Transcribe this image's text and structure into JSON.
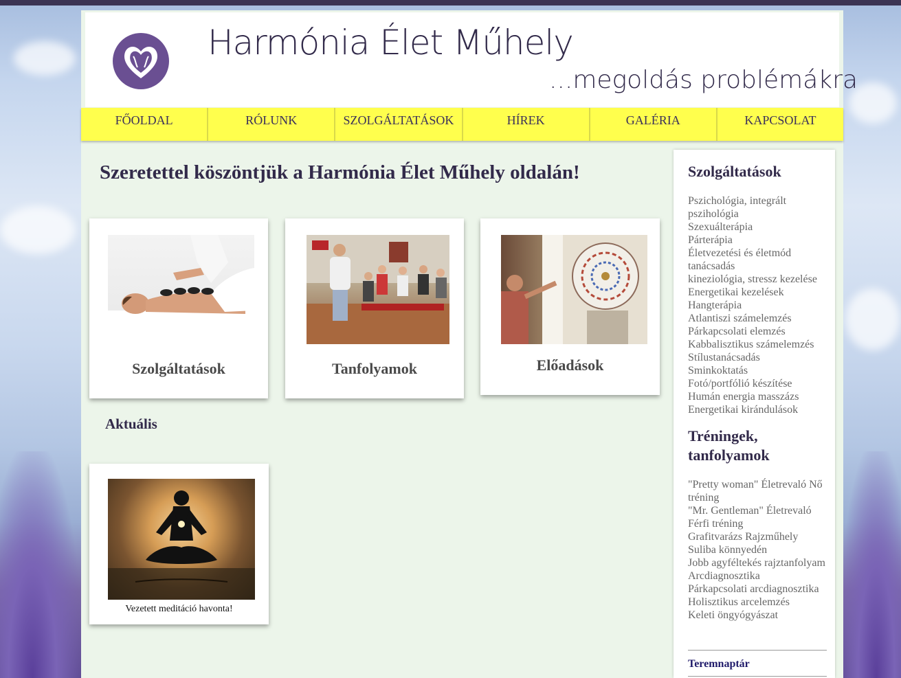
{
  "site": {
    "title": "Harmónia Élet Műhely",
    "tagline": "...megoldás problémákra"
  },
  "nav": {
    "items": [
      {
        "label": "FŐOLDAL"
      },
      {
        "label": "RÓLUNK"
      },
      {
        "label": "SZOLGÁLTATÁSOK"
      },
      {
        "label": "HÍREK"
      },
      {
        "label": "GALÉRIA"
      },
      {
        "label": "KAPCSOLAT"
      }
    ]
  },
  "main": {
    "title": "Szeretettel köszöntjük a Harmónia Élet Műhely oldalán!",
    "cards": [
      {
        "label": "Szolgáltatások"
      },
      {
        "label": "Tanfolyamok"
      },
      {
        "label": "Előadások"
      }
    ],
    "aktualis_heading": "Aktuális",
    "meditation_caption": "Vezetett meditáció havonta!"
  },
  "sidebar": {
    "services_heading": "Szolgáltatások",
    "services": [
      "Pszichológia, integrált pszihológia",
      "Szexuálterápia",
      "Párterápia",
      "Életvezetési és életmód tanácsadás",
      "kineziológia, stressz kezelése",
      "Energetikai kezelések",
      "Hangterápia",
      "Atlantiszi számelemzés",
      "Párkapcsolati elemzés",
      "Kabbalisztikus számelemzés",
      "Stílustanácsadás",
      "Sminkoktatás",
      "Fotó/portfólió készítése",
      "Humán energia masszázs",
      "Energetikai kirándulások"
    ],
    "trainings_heading": "Tréningek, tanfolyamok",
    "trainings": [
      "\"Pretty woman\" Életrevaló Nő tréning",
      "\"Mr. Gentleman\" Életrevaló Férfi tréning",
      "Grafitvarázs Rajzműhely",
      "Suliba könnyedén",
      "Jobb agyféltekés rajztanfolyam",
      "Arcdiagnosztika",
      "Párkapcsolati arcdiagnosztika",
      "Holisztikus arcelemzés",
      "Keleti öngyógyászat"
    ],
    "teremnaptar": "Teremnaptár"
  },
  "colors": {
    "nav_background": "#ffff4d",
    "content_background": "#ecf5ea",
    "heading_text": "#322a4a",
    "logo_purple": "#6a4f92"
  },
  "icons": {
    "logo": "heart-faces-logo-icon"
  }
}
